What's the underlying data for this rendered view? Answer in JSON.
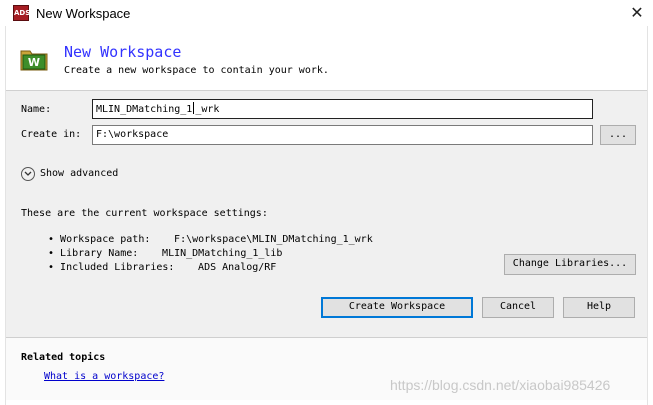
{
  "window": {
    "title": "New Workspace",
    "app_icon_text": "ADS"
  },
  "header": {
    "title": "New Workspace",
    "subtitle": "Create a new workspace to contain your work.",
    "icon": "workspace-w-folder-icon"
  },
  "form": {
    "name_label": "Name:",
    "name_value_before_caret": "MLIN_DMatching_1",
    "name_value_after_caret": "_wrk",
    "create_in_label": "Create in:",
    "create_in_value": "F:\\workspace",
    "browse_label": "..."
  },
  "advanced": {
    "label": "Show advanced",
    "icon": "chevron-down-circle-icon"
  },
  "settings": {
    "heading": "These are the current workspace settings:",
    "items": [
      {
        "label": "Workspace path:",
        "value": "F:\\workspace\\MLIN_DMatching_1_wrk"
      },
      {
        "label": "Library Name:",
        "value": "MLIN_DMatching_1_lib"
      },
      {
        "label": "Included Libraries:",
        "value": "ADS Analog/RF"
      }
    ],
    "change_libraries_label": "Change Libraries..."
  },
  "actions": {
    "create_label": "Create Workspace",
    "cancel_label": "Cancel",
    "help_label": "Help"
  },
  "related": {
    "heading": "Related topics",
    "link": "What is a workspace?"
  },
  "watermark": "https://blog.csdn.net/xiaobai985426",
  "colors": {
    "title_accent": "#3333ff",
    "default_button_border": "#0078d7",
    "link": "#0000cc"
  }
}
